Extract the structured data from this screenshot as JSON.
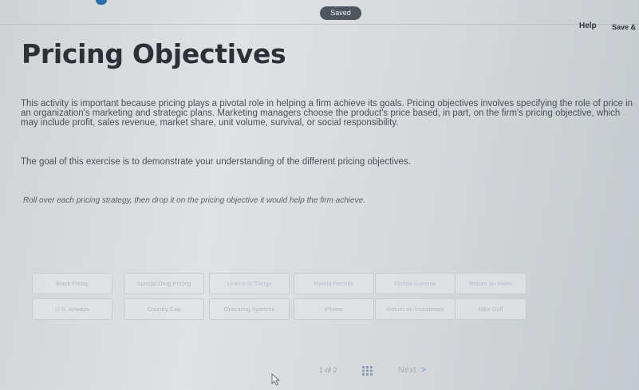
{
  "header": {
    "saved_status": "Saved",
    "help_label": "Help",
    "save_label": "Save &"
  },
  "page": {
    "title": "Pricing Objectives",
    "intro": "This activity is important because pricing plays a pivotal role in helping a firm achieve its goals. Pricing objectives involves specifying the role of price in an organization's marketing and strategic plans. Marketing managers choose the product's price based, in part, on the firm's pricing objective, which may include profit, sales revenue, market share, unit volume, survival, or social responsibility.",
    "goal": "The goal of this exercise is to demonstrate your understanding of the different pricing objectives.",
    "instruction": "Roll over each pricing strategy, then drop it on the pricing objective it would help the firm achieve."
  },
  "strategies": {
    "row1": [
      "Black Friday",
      "Special Drug Pricing",
      "Uniens in Things",
      "Hybrid Permits",
      "Florida Summer",
      "Return on Sales"
    ],
    "row2": [
      "U.S. Airways",
      "Country Cap",
      "Operating Systems",
      "iPhone",
      "Return on Investment",
      "Nike Golf"
    ]
  },
  "footer": {
    "page_indicator": "1 of 2",
    "next_label": "Next",
    "next_chevron": ">"
  },
  "icons": {
    "grid": "grid-icon",
    "cursor": "mouse-pointer-icon"
  },
  "colors": {
    "saved_pill": "#4f5660",
    "accent": "#2b6ea8",
    "next_chevron": "#7d96c6"
  }
}
